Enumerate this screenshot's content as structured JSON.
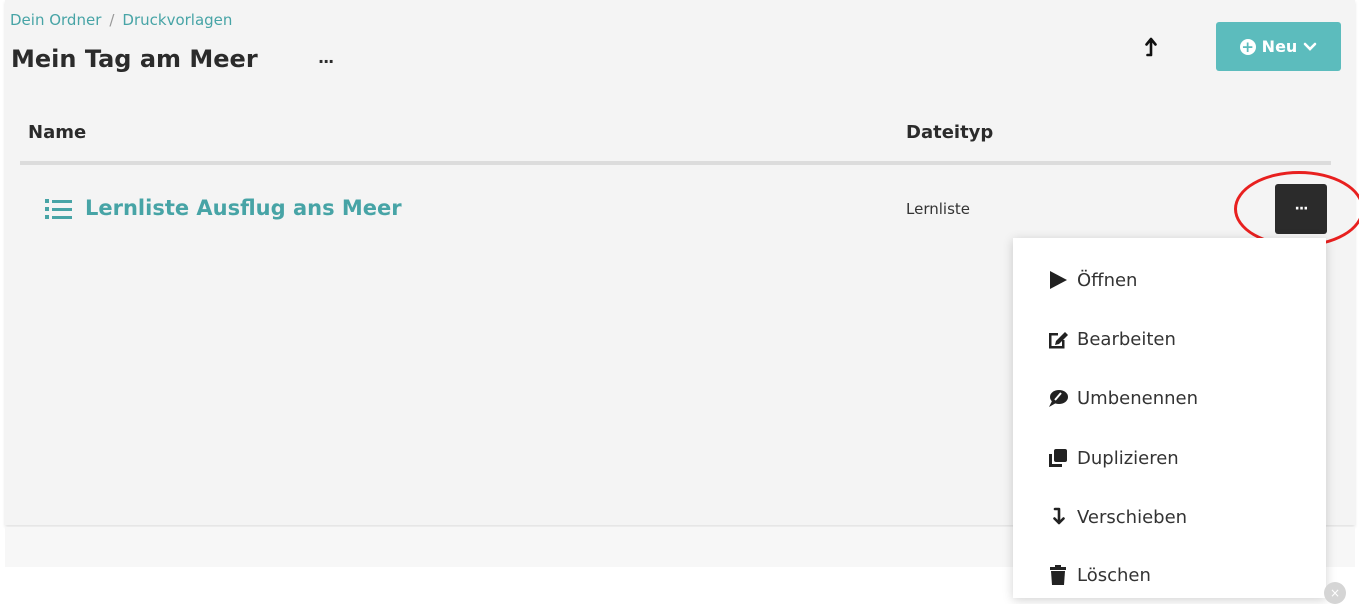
{
  "breadcrumb": {
    "items": [
      "Dein Ordner",
      "Druckvorlagen"
    ],
    "separator": "/"
  },
  "header": {
    "title": "Mein Tag am Meer",
    "more_label": "···",
    "new_button_label": "Neu"
  },
  "table": {
    "columns": {
      "name": "Name",
      "type": "Dateityp"
    },
    "rows": [
      {
        "name": "Lernliste Ausflug ans Meer",
        "type": "Lernliste",
        "icon": "list-icon",
        "more_label": "···"
      }
    ]
  },
  "context_menu": {
    "items": [
      {
        "label": "Öffnen",
        "icon": "play-icon"
      },
      {
        "label": "Bearbeiten",
        "icon": "edit-icon"
      },
      {
        "label": "Umbenennen",
        "icon": "rename-icon"
      },
      {
        "label": "Duplizieren",
        "icon": "duplicate-icon"
      },
      {
        "label": "Verschieben",
        "icon": "move-icon"
      },
      {
        "label": "Löschen",
        "icon": "trash-icon"
      }
    ]
  },
  "colors": {
    "accent": "#5cbcbd",
    "link": "#47a4a6",
    "highlight": "#e8201f",
    "dark": "#2b2b2b"
  }
}
